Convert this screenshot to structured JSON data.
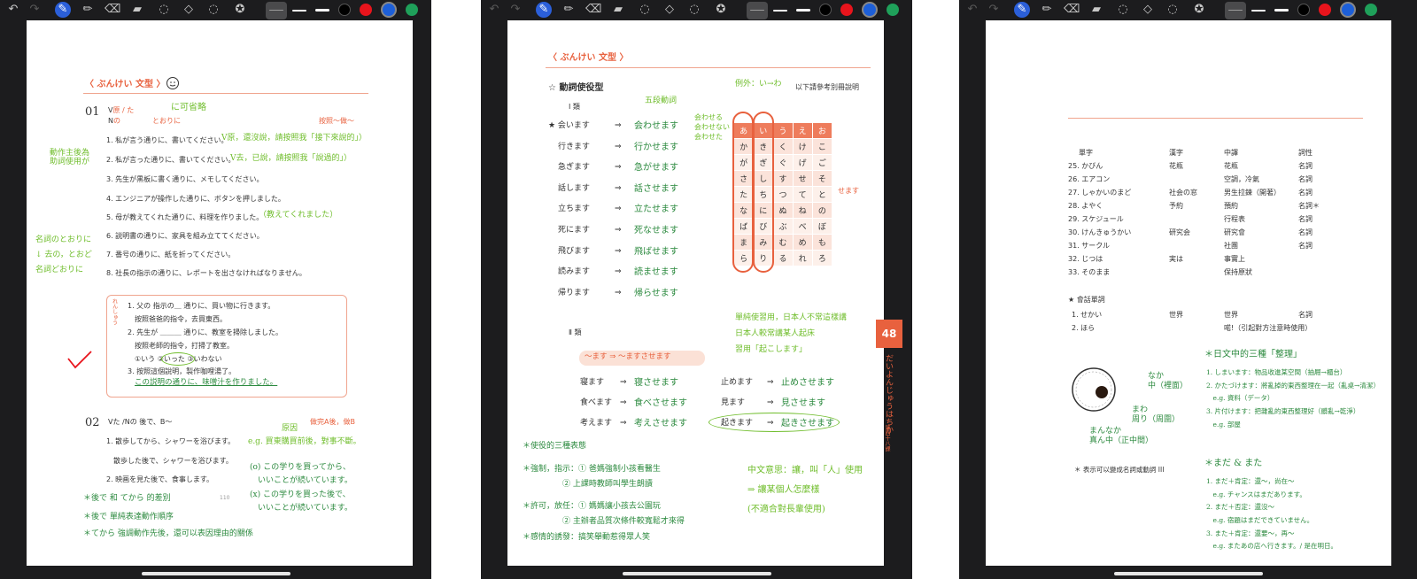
{
  "toolbar": {
    "undo": "↶",
    "redo": "↷",
    "pen": "✎",
    "pencil": "✏",
    "eraser": "⌫",
    "highlighter": "▰",
    "lasso": "◌",
    "shapes": "◇",
    "sticker": "✪",
    "colors": [
      "#ffffff",
      "#000000",
      "#e8141c",
      "#1d5fd8",
      "#1fa05a"
    ]
  },
  "page1": {
    "header": "〈 ぶんけい 文型 〉",
    "s01": {
      "num": "01",
      "form_v": "V",
      "form_v_suffix": "原 / た",
      "form_n": "N",
      "form_n_suffix": "の",
      "tooride": "とおりに",
      "copy": "按照～做～"
    },
    "sentences": [
      "1. 私が言う通りに、書いてください。",
      "2. 私が言った通りに、書いてください。",
      "3. 先生が黒板に書く通りに、メモしてください。",
      "4. エンジニアが操作した通りに、ボタンを押しました。",
      "5. 母が教えてくれた通りに、料理を作りました。",
      "6. 説明書の通りに、家具を組み立ててください。",
      "7. 番号の通りに、紙を折ってください。",
      "8. 社長の指示の通りに、レポートを出さなければなりません。"
    ],
    "practice": {
      "label": "れんしゅう",
      "q1": "1. 父の 指示の＿ 通りに、買い物に行きます。",
      "q1_zh": "按照爸爸的指令，去買東西。",
      "q2": "2. 先生が ＿＿＿ 通りに、教室を掃除しました。",
      "q2_zh": "按照老師的指令，打掃了教室。",
      "q2_opts": "①いう  ②いった  ③いわない",
      "q3": "3. 按照這個說明，製作咖哩湯了。",
      "q3_ans": "この説明の通りに、味噌汁を作りました。"
    },
    "s02": {
      "num": "02",
      "form": "Vた /Nの 後で、B～",
      "copy": "做完A後，做B",
      "lines": [
        "1. 散歩してから、シャワーを浴びます。",
        "散歩した後で、シャワーを浴びます。",
        "2. 映画を見た後で、食事します。"
      ],
      "page_num": "110"
    },
    "notes": {
      "n1": "に可省略",
      "n2": "V原，還沒說，請按照我「接下來說的」）",
      "n3": "V去，已說，請按照我「說過的」）",
      "n4": "（教えてくれました）",
      "n5": "動作主後為\n助詞使用が",
      "n6": "名詞のとおりに\n↓ 去の，とおど\n名詞どおりに",
      "n7": "e.g. 買東購買前後，對事不斷。",
      "n8": "(o) この学りを買ってから、\n　いいことが続いています。\n(x) この学りを買った後で、\n　いいことが続いています。",
      "n9": "＊後で 和 てから 的差別",
      "n10": "＊後で 單純表達動作順序",
      "n11": "＊てから 強調動作先後，還可以表因理由的關係",
      "n12": "原因"
    }
  },
  "page2": {
    "header": "〈 ぶんけい 文型 〉",
    "title": "☆ 動詞使役型",
    "ref": "以下請參考別冊說明",
    "g1": "Ⅰ 類",
    "g1_verbs": [
      "★ 会います",
      "行きます",
      "急ぎます",
      "話します",
      "立ちます",
      "死にます",
      "飛びます",
      "読みます",
      "帰ります"
    ],
    "g1_caus": [
      "会わせます",
      "行かせます",
      "急がせます",
      "話させます",
      "立たせます",
      "死なせます",
      "飛ばせます",
      "読ませます",
      "帰らせます"
    ],
    "arrow": "⇒",
    "kana_head": [
      "あ",
      "い",
      "う",
      "え",
      "お"
    ],
    "kana_rows": [
      [
        "か",
        "き",
        "く",
        "け",
        "こ"
      ],
      [
        "が",
        "ぎ",
        "ぐ",
        "げ",
        "ご"
      ],
      [
        "さ",
        "し",
        "す",
        "せ",
        "そ"
      ],
      [
        "た",
        "ち",
        "つ",
        "て",
        "と"
      ],
      [
        "な",
        "に",
        "ぬ",
        "ね",
        "の"
      ],
      [
        "ば",
        "び",
        "ぶ",
        "べ",
        "ぼ"
      ],
      [
        "ま",
        "み",
        "む",
        "め",
        "も"
      ],
      [
        "ら",
        "り",
        "る",
        "れ",
        "ろ"
      ]
    ],
    "semasu": "せます",
    "g2": "Ⅱ 類",
    "g2_rule": "～ます ⇒ ～ますさせます",
    "g2_left": [
      "寝ます",
      "食べます",
      "考えます"
    ],
    "g2_left_c": [
      "寝させます",
      "食べさせます",
      "考えさせます"
    ],
    "g2_right": [
      "止めます",
      "見ます",
      "起きます"
    ],
    "g2_right_c": [
      "止めさせます",
      "見させます",
      "起きさせます"
    ],
    "page_tab": "48",
    "side": "だいよんじゅうはちか",
    "side2": "第四十八課",
    "notes": {
      "a": "例外：い→わ",
      "b": "五段動詞",
      "c": "会わせる\n会わせない\n会わせた",
      "d": "單純使習用，日本人不常這樣講\n日本人較常講某人起床\n習用「起こします」",
      "e": "＊使役的三種表態",
      "f": "＊強制，指示：① 爸媽強制小孩看醫生\n　　　　　② 上課時教師叫學生朗讀",
      "g": "＊許可，放任：① 媽媽讓小孩去公園玩\n　　　　　② 主辦者品質次條件較寬鬆才來得",
      "h": "＊感情的誘發：搞笑舉動惹得眾人笑",
      "i": "中文意思：讓，叫「人」使用\n⇒ 讓某個人怎麼樣\n(不適合對長輩使用)"
    }
  },
  "page3": {
    "cols": [
      "單字",
      "漢字",
      "中譯",
      "詞性"
    ],
    "rows": [
      [
        "25. かびん",
        "花瓶",
        "花瓶",
        "名詞"
      ],
      [
        "26. エアコン",
        "",
        "空調，冷氣",
        "名詞"
      ],
      [
        "27. しゃかいのまど",
        "社会の窓",
        "男生拉鍊（開著）",
        "名詞"
      ],
      [
        "28. よやく",
        "予約",
        "預約",
        "名詞＊"
      ],
      [
        "29. スケジュール",
        "",
        "行程表",
        "名詞"
      ],
      [
        "30. けんきゅうかい",
        "研究会",
        "研究會",
        "名詞"
      ],
      [
        "31. サークル",
        "",
        "社團",
        "名詞"
      ],
      [
        "32. じつは",
        "実は",
        "事實上",
        ""
      ],
      [
        "33. そのまま",
        "",
        "保持原狀",
        ""
      ]
    ],
    "conv_title": "★ 會話單詞",
    "conv_rows": [
      [
        "1. せかい",
        "世界",
        "世界",
        "名詞"
      ],
      [
        "2. ほら",
        "",
        "喏!（引起對方注意時使用）",
        ""
      ]
    ],
    "footnote": "＊ 表示可以變成名詞或動詞 III",
    "notes": {
      "a": "＊日文中的三種「整理」",
      "b": "1. しまいます：物品收進某空間（抽屜→櫃台）\n2. かたづけます：將亂掉的東西整理在一起（亂桌→清潔）\n　e.g. 資料（データ）\n3. 片付けます：把雜亂的東西整理好（髒亂→乾淨）\n　e.g. 部屋",
      "c": "＊まだ & また",
      "d": "1. まだ＋肯定：還～，尚在～\n　e.g. チャンスはまだあります。\n2. まだ＋否定：還沒～\n　e.g. 宿題はまだできていません。\n3. また＋肯定：還要～，再～\n　e.g. またあの店へ行きます。/ 是在明日。",
      "e": "なか\n中（裡面）",
      "f": "まわ\n周り（周圍）",
      "g": "まんなか\n真ん中（正中間）"
    }
  }
}
